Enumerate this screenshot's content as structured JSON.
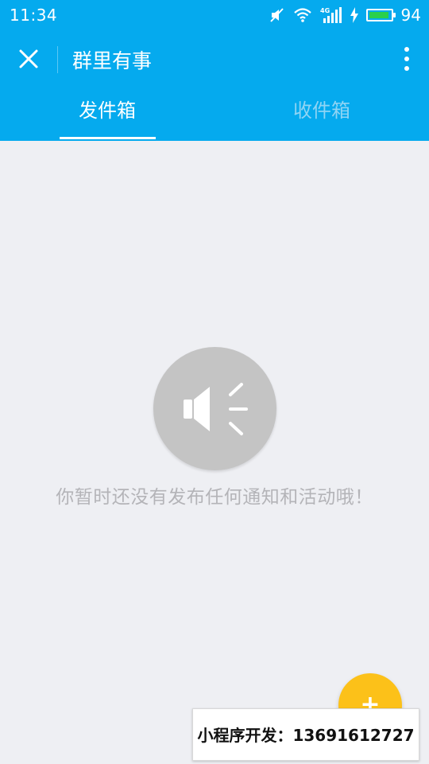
{
  "status_bar": {
    "time": "11:34",
    "network_label": "4G",
    "battery_percent": "94",
    "battery_level": 0.94
  },
  "header": {
    "title": "群里有事",
    "close_icon": "close-icon",
    "more_icon": "more-vertical-icon"
  },
  "tabs": [
    {
      "label": "发件箱",
      "selected": true
    },
    {
      "label": "收件箱",
      "selected": false
    }
  ],
  "empty_state": {
    "icon": "speaker-icon",
    "message": "你暂时还没有发布任何通知和活动哦！"
  },
  "fab": {
    "label": "+"
  },
  "watermark": {
    "text": "小程序开发：13691612727"
  },
  "colors": {
    "primary": "#05aaee",
    "background": "#eeeff3",
    "fab": "#fcc119",
    "empty_icon_bg": "#c4c4c4",
    "empty_text": "#b4b4b8",
    "inactive_tab": "#8fd4f4"
  }
}
